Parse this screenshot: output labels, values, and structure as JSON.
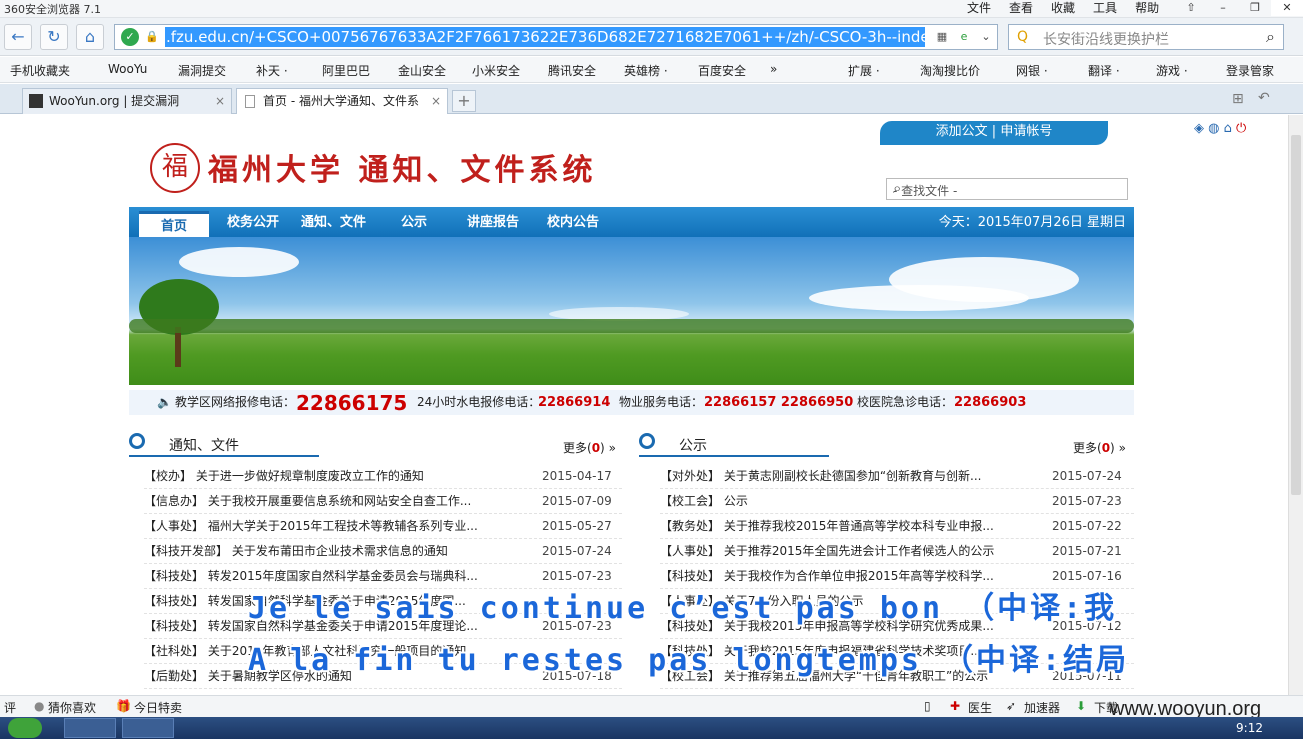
{
  "window": {
    "title": "360安全浏览器 7.1"
  },
  "menu": [
    "文件",
    "查看",
    "收藏",
    "工具",
    "帮助"
  ],
  "address": {
    "url": ".fzu.edu.cn/+CSCO+00756767633A2F2F766173622E736D682E7271682E7061++/zh/-CSCO-3h--index.do"
  },
  "search": {
    "placeholder": "长安街沿线更换护栏"
  },
  "bookmarks": [
    "手机收藏夹",
    "WooYu",
    "漏洞提交",
    "补天 ·",
    "阿里巴巴",
    "金山安全",
    "小米安全",
    "腾讯安全",
    "英雄榜 ·",
    "百度安全",
    "»",
    "扩展 ·",
    "淘淘搜比价",
    "网银 ·",
    "翻译 ·",
    "游戏 ·",
    "登录管家"
  ],
  "tabs": [
    {
      "label": "WooYun.org | 提交漏洞",
      "close": "×"
    },
    {
      "label": "首页 - 福州大学通知、文件系",
      "close": "×"
    }
  ],
  "site": {
    "top_links": "添加公文 | 申请帐号",
    "seal": "福",
    "logo": "福州大学 通知、文件系统",
    "search_placeholder": "- 查找文件 -",
    "nav": [
      "首页",
      "校务公开",
      "通知、文件",
      "公示",
      "讲座报告",
      "校内公告"
    ],
    "today": "今天：2015年07月26日  星期日",
    "phones": [
      {
        "label": "教学区网络报修电话：",
        "value": "22866175"
      },
      {
        "label": "24小时水电报修电话：",
        "value": "22866914"
      },
      {
        "label": "物业服务电话：",
        "value": "22866157  22866950"
      },
      {
        "label": "校医院急诊电话：",
        "value": "22866903"
      }
    ]
  },
  "notices": {
    "title": "通知、文件",
    "more_label": "更多(",
    "more_count": "0",
    "more_suffix": ")",
    "items": [
      {
        "text": "【校办】 关于进一步做好规章制度废改立工作的通知",
        "date": "2015-04-17"
      },
      {
        "text": "【信息办】 关于我校开展重要信息系统和网站安全自查工作...",
        "date": "2015-07-09"
      },
      {
        "text": "【人事处】 福州大学关于2015年工程技术等教辅各系列专业...",
        "date": "2015-05-27"
      },
      {
        "text": "【科技开发部】 关于发布莆田市企业技术需求信息的通知",
        "date": "2015-07-24"
      },
      {
        "text": "【科技处】 转发2015年度国家自然科学基金委员会与瑞典科...",
        "date": "2015-07-23"
      },
      {
        "text": "【科技处】 转发国家自然科学基金委关于申请2015年度国...",
        "date": ""
      },
      {
        "text": "【科技处】 转发国家自然科学基金委关于申请2015年度理论...",
        "date": "2015-07-23"
      },
      {
        "text": "【社科处】 关于2015年教育部人文社科研究一般项目的通知",
        "date": ""
      },
      {
        "text": "【后勤处】 关于暑期教学区停水的通知",
        "date": "2015-07-18"
      }
    ]
  },
  "announcements": {
    "title": "公示",
    "more_label": "更多(",
    "more_count": "0",
    "more_suffix": ")",
    "items": [
      {
        "text": "【对外处】 关于黄志刚副校长赴德国参加“创新教育与创新...",
        "date": "2015-07-24"
      },
      {
        "text": "【校工会】 公示",
        "date": "2015-07-23"
      },
      {
        "text": "【教务处】 关于推荐我校2015年普通高等学校本科专业申报...",
        "date": "2015-07-22"
      },
      {
        "text": "【人事处】 关于推荐2015年全国先进会计工作者候选人的公示",
        "date": "2015-07-21"
      },
      {
        "text": "【科技处】 关于我校作为合作单位申报2015年高等学校科学...",
        "date": "2015-07-16"
      },
      {
        "text": "【人事处】 关于7月份入职人员的公示",
        "date": ""
      },
      {
        "text": "【科技处】 关于我校2015年申报高等学校科学研究优秀成果...",
        "date": "2015-07-12"
      },
      {
        "text": "【科技处】 关于我校2015年度申报福建省科学技术奖项目...",
        "date": ""
      },
      {
        "text": "【校工会】 关于推荐第五届福州大学“十佳青年教职工”的公示",
        "date": "2015-07-11"
      }
    ]
  },
  "subtitles": [
    "Je le sais continue c’est pas bon  （中译:我",
    "A la fin tu restes pas longtemps （中译:结局"
  ],
  "status": {
    "left1": "评",
    "left2": "猜你喜欢",
    "left3": "今日特卖",
    "r1": "医生",
    "r2": "加速器",
    "r3": "下载"
  },
  "watermark": "www.wooyun.org",
  "clock": "9:12"
}
